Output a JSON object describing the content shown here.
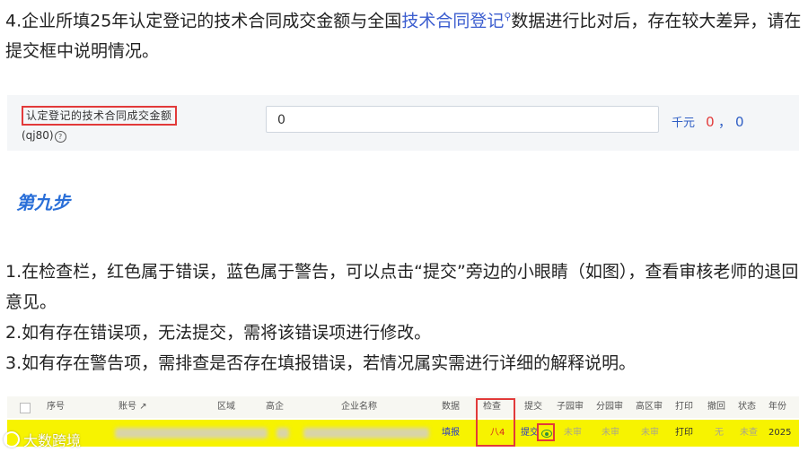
{
  "step4": {
    "before": "4.企业所填25年认定登记的技术合同成交金额与全国",
    "link": "技术合同登记",
    "link_icon": "search-icon",
    "after": "数据进行比对后，存在较大差异，请在提交框中说明情况。"
  },
  "form": {
    "label": "认定登记的技术合同成交金额",
    "code": "(qj80)",
    "help_icon": "question-circle-icon",
    "value": "0",
    "unit": "千元",
    "red_value": "0",
    "separator": "，",
    "blue_value": "0"
  },
  "step9": {
    "heading": "第九步"
  },
  "instructions": [
    "1.在检查栏，红色属于错误，蓝色属于警告，可以点击“提交”旁边的小眼睛（如图），查看审核老师的退回意见。",
    "2.如有存在错误项，无法提交，需将该错误项进行修改。",
    "3.如有存在警告项，需排查是否存在填报错误，若情况属实需进行详细的解释说明。"
  ],
  "grid": {
    "headers": {
      "seq": "序号",
      "account": "账号",
      "account_icon": "external-link-icon",
      "region": "区域",
      "hightech": "高企",
      "company": "企业名称",
      "data": "数据",
      "check": "检查",
      "submit": "提交",
      "sub_review": "子园审",
      "branch_review": "分园审",
      "zone_review": "高区审",
      "print": "打印",
      "withdraw": "撤回",
      "status": "状态",
      "year": "年份"
    },
    "row": {
      "data": "填报",
      "check": "八4",
      "submit": "提交",
      "eye_icon": "eye-icon",
      "sub_review": "未审",
      "branch_review": "未审",
      "zone_review": "未审",
      "print": "打印",
      "withdraw": "无",
      "status": "未查",
      "year": "2025"
    },
    "colors": {
      "row_bg": "#f7f300",
      "error": "#d4271f",
      "link": "#2b3cc4"
    }
  },
  "watermark": {
    "text": "大数跨境",
    "icon": "brand-logo-icon"
  }
}
